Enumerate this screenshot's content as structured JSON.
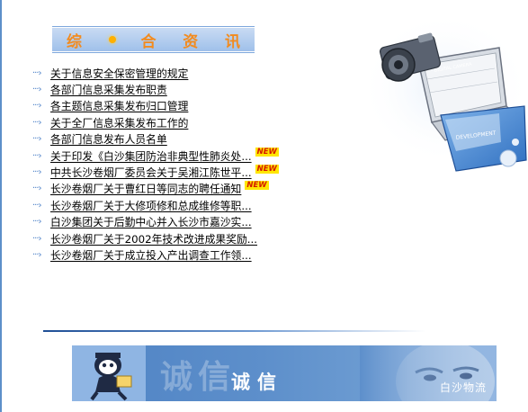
{
  "section": {
    "title_chars": [
      "综",
      "合",
      "资",
      "讯"
    ]
  },
  "news": [
    {
      "title": "关于信息安全保密管理的规定",
      "new": false
    },
    {
      "title": "各部门信息采集发布职责",
      "new": false
    },
    {
      "title": "各主题信息采集发布归口管理",
      "new": false
    },
    {
      "title": "关于全厂信息采集发布工作的",
      "new": false
    },
    {
      "title": "各部门信息发布人员名单",
      "new": false
    },
    {
      "title": "关于印发《白沙集团防治非典型性肺炎处...",
      "new": true
    },
    {
      "title": "中共长沙卷烟厂委员会关于吴湘江陈世平...",
      "new": true
    },
    {
      "title": "长沙卷烟厂关于曹红日等同志的聘任通知",
      "new": true
    },
    {
      "title": "长沙卷烟厂关于大修项修和总成维修等职...",
      "new": false
    },
    {
      "title": "白沙集团关于后勤中心并入长沙市嘉沙实...",
      "new": false
    },
    {
      "title": "长沙卷烟厂关于2002年技术改进成果奖励...",
      "new": false
    },
    {
      "title": "长沙卷烟厂关于成立投入产出调查工作领...",
      "new": false
    }
  ],
  "badge_text": "NEW",
  "bullet_symbol": "···›",
  "hero": {
    "label_top": "DIGITAL CAMERA",
    "label_bottom": "DEVELOPMENT"
  },
  "banner": {
    "big_text": "诚信",
    "small_text": "诚信",
    "caption": "白沙物流"
  },
  "colors": {
    "title_orange": "#f28b1f",
    "link": "#000000",
    "bullet": "#4a7fc7",
    "banner_blue": "#5d8fcb"
  }
}
